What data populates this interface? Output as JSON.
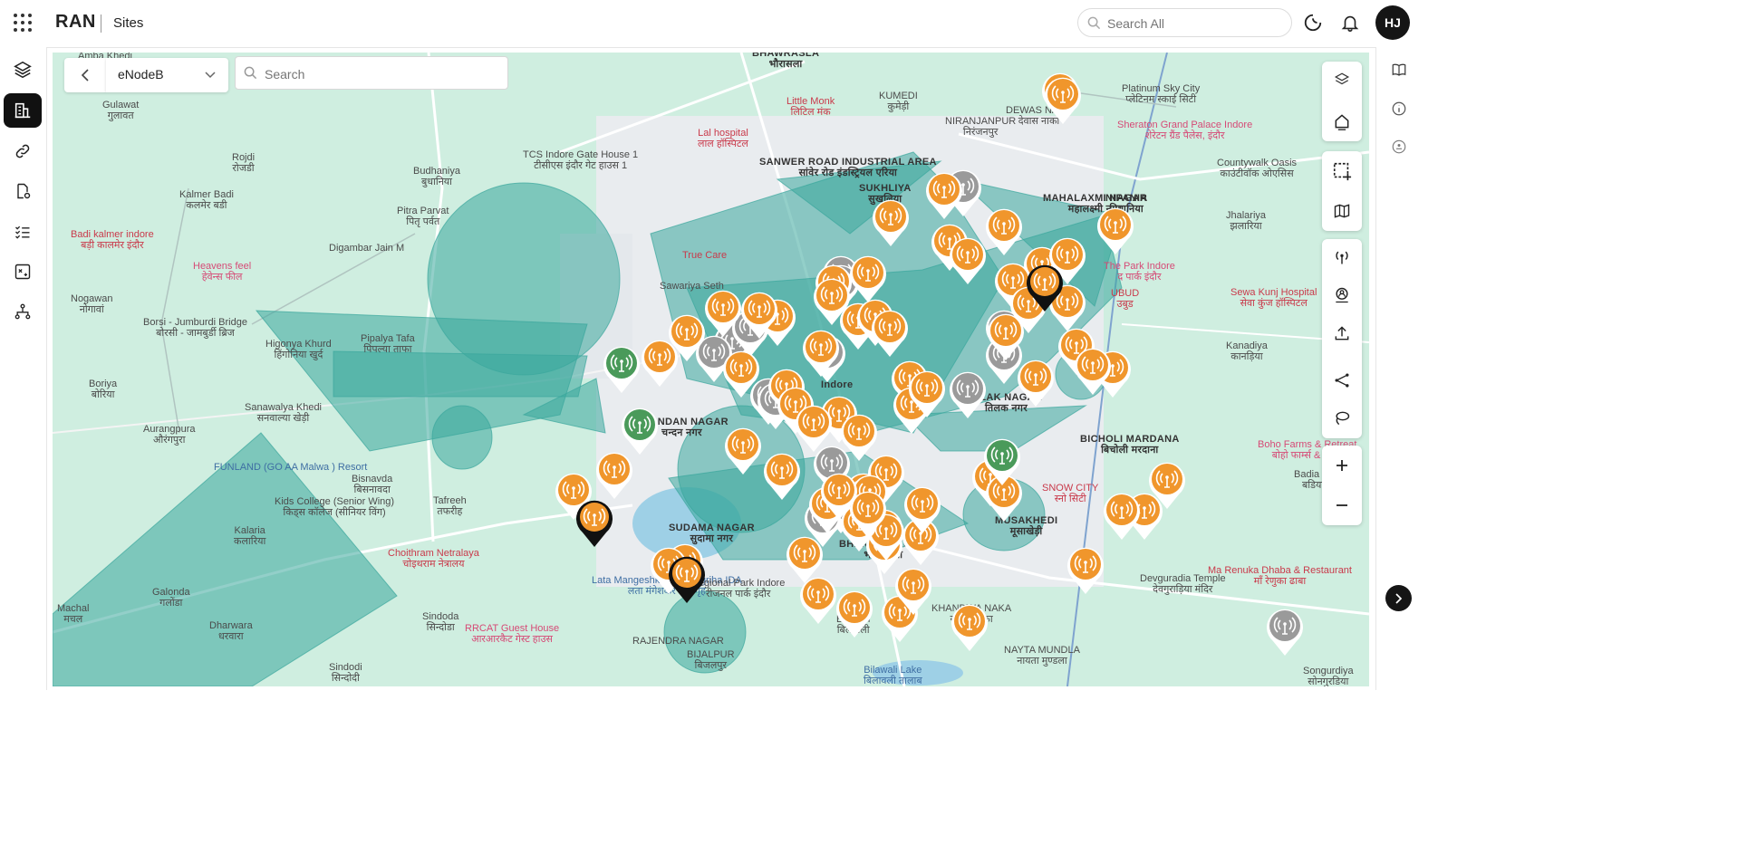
{
  "header": {
    "app_name": "RAN",
    "page_title": "Sites",
    "search_placeholder": "Search All",
    "user_initials": "HJ"
  },
  "sidebar": {
    "items": [
      {
        "name": "layers",
        "icon": "stack-icon",
        "active": false
      },
      {
        "name": "sites",
        "icon": "building-chart-icon",
        "active": true
      },
      {
        "name": "links",
        "icon": "link-icon",
        "active": false
      },
      {
        "name": "documents",
        "icon": "document-gear-icon",
        "active": false
      },
      {
        "name": "tasks",
        "icon": "checklist-icon",
        "active": false
      },
      {
        "name": "reports",
        "icon": "chart-box-icon",
        "active": false
      },
      {
        "name": "topology",
        "icon": "network-icon",
        "active": false
      }
    ]
  },
  "map_controls": {
    "layer_type_value": "eNodeB",
    "search_placeholder": "Search"
  },
  "colors": {
    "accent": "#111111",
    "coverage": "#3aa79c",
    "pin_orange": "#f0962c",
    "pin_grey": "#9a9a9a",
    "pin_green": "#4a9a5a",
    "map_land": "#cfeee0"
  },
  "map_labels": [
    {
      "text": "Amba Khedi",
      "sub": "",
      "cls": ""
    },
    {
      "text": "BHAWRASLA",
      "sub": "भौरासला",
      "cls": "big"
    },
    {
      "text": "Gulawat",
      "sub": "गुलावत",
      "cls": ""
    },
    {
      "text": "Rojdi",
      "sub": "रोजडी",
      "cls": ""
    },
    {
      "text": "Budhaniya",
      "sub": "बुधानिया",
      "cls": ""
    },
    {
      "text": "Kalmer Badi",
      "sub": "कलमेर बडी",
      "cls": ""
    },
    {
      "text": "Badi kalmer indore",
      "sub": "बड़ी कालमेर इंदौर",
      "cls": "red"
    },
    {
      "text": "Heavens feel",
      "sub": "हेवेन्स फील",
      "cls": "poi"
    },
    {
      "text": "Digambar Jain M",
      "sub": "",
      "cls": ""
    },
    {
      "text": "Nogawan",
      "sub": "नोगावां",
      "cls": ""
    },
    {
      "text": "Borsi - Jumburdi Bridge",
      "sub": "बोरसी - जामबुर्डी ब्रिज",
      "cls": ""
    },
    {
      "text": "Higonya Khurd",
      "sub": "हिंगोनिया खुर्द",
      "cls": ""
    },
    {
      "text": "Pipalya Tafa",
      "sub": "पिपल्या ताफा",
      "cls": ""
    },
    {
      "text": "Boriya",
      "sub": "बोरिया",
      "cls": ""
    },
    {
      "text": "Aurangpura",
      "sub": "औरंगपुरा",
      "cls": ""
    },
    {
      "text": "Sanawalya Khedi",
      "sub": "सनवाल्या खेड़ी",
      "cls": ""
    },
    {
      "text": "Bisnavda",
      "sub": "बिसनावदा",
      "cls": ""
    },
    {
      "text": "FUNLAND (GO AA Malwa ) Resort",
      "sub": "",
      "cls": "blue"
    },
    {
      "text": "Kids College (Senior Wing)",
      "sub": "किड्स कॉलेज (सीनियर विंग)",
      "cls": ""
    },
    {
      "text": "Kalaria",
      "sub": "कलारिया",
      "cls": ""
    },
    {
      "text": "Galonda",
      "sub": "गलोंडा",
      "cls": ""
    },
    {
      "text": "Machal",
      "sub": "मचल",
      "cls": ""
    },
    {
      "text": "Dharwara",
      "sub": "धरवारा",
      "cls": ""
    },
    {
      "text": "Sindoda",
      "sub": "सिन्दोडा",
      "cls": ""
    },
    {
      "text": "Sindodi",
      "sub": "सिन्दोदी",
      "cls": ""
    },
    {
      "text": "RRCAT Guest House",
      "sub": "आरआरकैट गेस्ट हाउस",
      "cls": "poi"
    },
    {
      "text": "Choithram Netralaya",
      "sub": "चोइथराम नेत्रालय",
      "cls": "red"
    },
    {
      "text": "Lata Mangeshkar Sabhagriha IDA",
      "sub": "लता मंगेशकर सभागृह",
      "cls": "blue"
    },
    {
      "text": "SUDAMA NAGAR",
      "sub": "सुदामा नगर",
      "cls": "big"
    },
    {
      "text": "Regional Park Indore",
      "sub": "रीजनल पार्क इंदौर",
      "cls": ""
    },
    {
      "text": "Bilawali",
      "sub": "बिलावली",
      "cls": ""
    },
    {
      "text": "Bilawali Lake",
      "sub": "बिलावली तालाब",
      "cls": "blue"
    },
    {
      "text": "BHANWAR KUWA",
      "sub": "भंवर कुआं",
      "cls": "big"
    },
    {
      "text": "TCS Indore Gate House 1",
      "sub": "टीसीएस इंदौर गेट हाउस 1",
      "cls": ""
    },
    {
      "text": "Lal hospital",
      "sub": "लाल हॉस्पिटल",
      "cls": "red"
    },
    {
      "text": "Little Monk",
      "sub": "लिटिल मंक",
      "cls": "red"
    },
    {
      "text": "SANWER ROAD INDUSTRIAL AREA",
      "sub": "सांवेर रोड इंडस्ट्रियल एरिया",
      "cls": "big"
    },
    {
      "text": "SUKHLIYA",
      "sub": "सुखलिया",
      "cls": "big"
    },
    {
      "text": "KUMEDI",
      "sub": "कुमेड़ी",
      "cls": ""
    },
    {
      "text": "NIRANJANPUR",
      "sub": "निरंजनपुर",
      "cls": ""
    },
    {
      "text": "DEWAS NAKA",
      "sub": "देवास नाका",
      "cls": ""
    },
    {
      "text": "Platinum Sky City",
      "sub": "प्लेटिनम स्काई सिटी",
      "cls": ""
    },
    {
      "text": "Sheraton Grand Palace Indore",
      "sub": "शेरेटन ग्रैंड पैलेस, इंदौर",
      "cls": "poi"
    },
    {
      "text": "Countywalk Oasis",
      "sub": "काउंटीवॉक ओएसिस",
      "cls": ""
    },
    {
      "text": "MAHALAXMI NAGAR",
      "sub": "महालक्ष्मी नगर",
      "cls": "big"
    },
    {
      "text": "NIPANIA",
      "sub": "निपानिया",
      "cls": "big"
    },
    {
      "text": "Jhalariya",
      "sub": "झलारिया",
      "cls": ""
    },
    {
      "text": "The Park Indore",
      "sub": "द पार्क इंदौर",
      "cls": "poi"
    },
    {
      "text": "UBUD",
      "sub": "उबुड",
      "cls": "red"
    },
    {
      "text": "Sewa Kunj Hospital",
      "sub": "सेवा कुंज हॉस्पिटल",
      "cls": "red"
    },
    {
      "text": "Kanadiya",
      "sub": "कानड़िया",
      "cls": ""
    },
    {
      "text": "BICHOLI MARDANA",
      "sub": "बिचोली मरदाना",
      "cls": "big"
    },
    {
      "text": "Boho Farms & Retreat",
      "sub": "बोहो फार्म्स & रिट्रीट",
      "cls": "poi"
    },
    {
      "text": "Badia Keema",
      "sub": "बडिया कीमा",
      "cls": ""
    },
    {
      "text": "SNOW CITY",
      "sub": "स्नो सिटी",
      "cls": "red"
    },
    {
      "text": "MUSAKHEDI",
      "sub": "मूसाखेड़ी",
      "cls": "big"
    },
    {
      "text": "Ma Renuka Dhaba & Restaurant",
      "sub": "माँ रेणुका ढाबा",
      "cls": "red"
    },
    {
      "text": "Devguradia Temple",
      "sub": "देवगुराड़िया मंदिर",
      "cls": ""
    },
    {
      "text": "Songurdiya",
      "sub": "सोनगुरडिया",
      "cls": ""
    },
    {
      "text": "KHANDWA NAKA",
      "sub": "खंडवा नाका",
      "cls": ""
    },
    {
      "text": "NAYTA MUNDLA",
      "sub": "नायता मुण्डला",
      "cls": ""
    },
    {
      "text": "CHANDAN NAGAR",
      "sub": "चन्दन नगर",
      "cls": "big"
    },
    {
      "text": "TILAK NAGAR",
      "sub": "तिलक नगर",
      "cls": "big"
    },
    {
      "text": "RAJENDRA NAGAR",
      "sub": "",
      "cls": ""
    },
    {
      "text": "BIJALPUR",
      "sub": "बिजलपुर",
      "cls": ""
    },
    {
      "text": "Tafreeh",
      "sub": "तफरीह",
      "cls": ""
    },
    {
      "text": "Pitra Parvat",
      "sub": "पितृ पर्वत",
      "cls": ""
    },
    {
      "text": "Sawariya Seth",
      "sub": "",
      "cls": ""
    },
    {
      "text": "True Care",
      "sub": "",
      "cls": "red"
    },
    {
      "text": "Indore",
      "sub": "",
      "cls": "big"
    }
  ],
  "sites": {
    "orange_count": 70,
    "grey_count": 16,
    "green_count": 3,
    "selected_count": 3
  }
}
